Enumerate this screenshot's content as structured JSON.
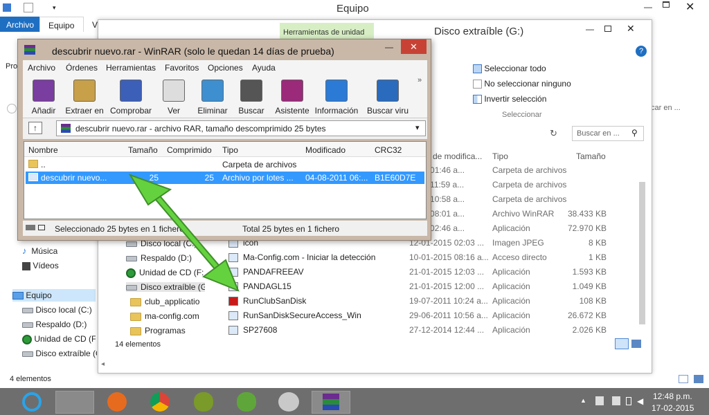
{
  "equipo_window": {
    "title": "Equipo",
    "tabs": [
      "Archivo",
      "Equipo",
      "Vi"
    ],
    "pro_label": "Pro",
    "status": "4 elementos",
    "search_placeholder": "car en ...",
    "nav": [
      {
        "label": "Música",
        "type": "music"
      },
      {
        "label": "Vídeos",
        "type": "video"
      },
      {
        "label": "Equipo",
        "type": "pc"
      },
      {
        "label": "Disco local (C:)",
        "type": "drive"
      },
      {
        "label": "Respaldo (D:)",
        "type": "drive"
      },
      {
        "label": "Unidad de CD (F:",
        "type": "cd"
      },
      {
        "label": "Disco extraíble (G",
        "type": "drive"
      }
    ]
  },
  "disco_window": {
    "title": "Disco extraíble (G:)",
    "ribbon_tab": "Herramientas de unidad",
    "select_group": {
      "items": [
        "Seleccionar todo",
        "No seleccionar ninguno",
        "Invertir selección"
      ],
      "label": "Seleccionar"
    },
    "search_placeholder": "Buscar en ...",
    "columns": [
      "de modifica...",
      "Tipo",
      "Tamaño"
    ],
    "nav": [
      {
        "label": "Disco local (C:)",
        "type": "drive"
      },
      {
        "label": "Respaldo (D:)",
        "type": "drive"
      },
      {
        "label": "Unidad de CD (F:",
        "type": "cd"
      },
      {
        "label": "Disco extraíble (G:",
        "type": "drive"
      },
      {
        "label": "club_applicatio",
        "type": "folder"
      },
      {
        "label": "ma-config.com",
        "type": "folder"
      },
      {
        "label": "Programas",
        "type": "folder"
      }
    ],
    "files": [
      {
        "name": "",
        "date": "2014 01:46 a...",
        "type": "Carpeta de archivos",
        "size": ""
      },
      {
        "name": "",
        "date": "2014 11:59 a...",
        "type": "Carpeta de archivos",
        "size": ""
      },
      {
        "name": "",
        "date": "2015 10:58 a...",
        "type": "Carpeta de archivos",
        "size": ""
      },
      {
        "name": "",
        "date": "2014 08:01 a...",
        "type": "Archivo WinRAR",
        "size": "38.433 KB"
      },
      {
        "name": "",
        "date": "2014 02:46 a...",
        "type": "Aplicación",
        "size": "72.970 KB"
      },
      {
        "name": "icon",
        "date": "12-01-2015 02:03 ...",
        "type": "Imagen JPEG",
        "size": "8 KB"
      },
      {
        "name": "Ma-Config.com - Iniciar la detección",
        "date": "10-01-2015 08:16 a...",
        "type": "Acceso directo",
        "size": "1 KB"
      },
      {
        "name": "PANDAFREEAV",
        "date": "21-01-2015 12:03 ...",
        "type": "Aplicación",
        "size": "1.593 KB"
      },
      {
        "name": "PANDAGL15",
        "date": "21-01-2015 12:00 ...",
        "type": "Aplicación",
        "size": "1.049 KB"
      },
      {
        "name": "RunClubSanDisk",
        "date": "19-07-2011 10:24 a...",
        "type": "Aplicación",
        "size": "108 KB"
      },
      {
        "name": "RunSanDiskSecureAccess_Win",
        "date": "29-06-2011 10:56 a...",
        "type": "Aplicación",
        "size": "26.672 KB"
      },
      {
        "name": "SP27608",
        "date": "27-12-2014 12:44 ...",
        "type": "Aplicación",
        "size": "2.026 KB"
      }
    ],
    "status": "14 elementos"
  },
  "winrar": {
    "title": "descubrir nuevo.rar - WinRAR (solo le quedan 14 días de prueba)",
    "menu": [
      "Archivo",
      "Órdenes",
      "Herramientas",
      "Favoritos",
      "Opciones",
      "Ayuda"
    ],
    "toolbar": [
      "Añadir",
      "Extraer en",
      "Comprobar",
      "Ver",
      "Eliminar",
      "Buscar",
      "Asistente",
      "Información",
      "Buscar viru"
    ],
    "path": "descubrir nuevo.rar - archivo RAR, tamaño descomprimido 25 bytes",
    "columns": [
      "Nombre",
      "Tamaño",
      "Comprimido",
      "Tipo",
      "Modificado",
      "CRC32"
    ],
    "rows": [
      {
        "name": "..",
        "size": "",
        "packed": "",
        "type": "Carpeta de archivos",
        "modified": "",
        "crc": ""
      },
      {
        "name": "descubrir nuevo...",
        "size": "25",
        "packed": "25",
        "type": "Archivo por lotes ...",
        "modified": "04-08-2011 06:...",
        "crc": "B1E60D7E"
      }
    ],
    "status_left": "Seleccionado 25 bytes en 1 fichero",
    "status_right": "Total 25 bytes en 1 fichero"
  },
  "taskbar": {
    "time": "12:48 p.m.",
    "date": "17-02-2015"
  },
  "colors": {
    "accent": "#1e6fc2",
    "taskbar": "#6e6e6e",
    "winrar_frame": "#c9b8a8",
    "selection": "#3399ff",
    "arrow": "#56c23a"
  }
}
